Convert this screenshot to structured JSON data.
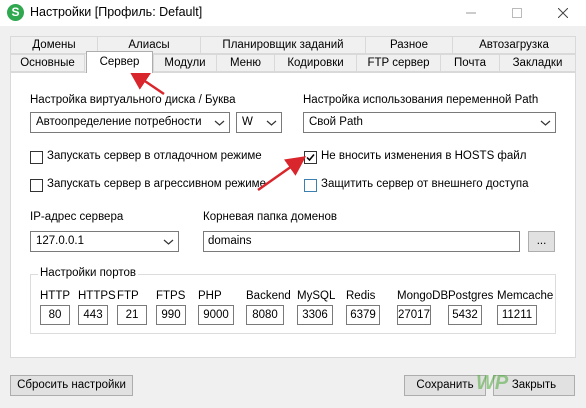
{
  "window": {
    "title": "Настройки [Профиль: Default]",
    "app_icon_letter": "S"
  },
  "tabs": {
    "row1": [
      "Домены",
      "Алиасы",
      "Планировщик заданий",
      "Разное",
      "Автозагрузка"
    ],
    "row2": [
      "Основные",
      "Сервер",
      "Модули",
      "Меню",
      "Кодировки",
      "FTP сервер",
      "Почта",
      "Закладки"
    ],
    "active": "Сервер"
  },
  "disk": {
    "label": "Настройка виртуального диска / Буква",
    "mode_value": "Автоопределение потребности",
    "letter_value": "W"
  },
  "path": {
    "label": "Настройка использования переменной Path",
    "value": "Свой Path"
  },
  "checkboxes": {
    "debug_mode": "Запускать сервер в отладочном режиме",
    "aggressive_mode": "Запускать сервер в агрессивном режиме",
    "no_hosts": "Не вносить изменения в HOSTS файл",
    "protect_external": "Защитить сервер от внешнего доступа"
  },
  "checkbox_states": {
    "debug_mode": false,
    "aggressive_mode": false,
    "no_hosts": true,
    "protect_external": false
  },
  "ip": {
    "label": "IP-адрес сервера",
    "value": "127.0.0.1"
  },
  "domains_folder": {
    "label": "Корневая папка доменов",
    "value": "domains",
    "browse_label": "..."
  },
  "ports": {
    "group_label": "Настройки портов",
    "items": [
      {
        "name": "HTTP",
        "value": "80"
      },
      {
        "name": "HTTPS",
        "value": "443"
      },
      {
        "name": "FTP",
        "value": "21"
      },
      {
        "name": "FTPS",
        "value": "990"
      },
      {
        "name": "PHP",
        "value": "9000"
      },
      {
        "name": "Backend",
        "value": "8080"
      },
      {
        "name": "MySQL",
        "value": "3306"
      },
      {
        "name": "Redis",
        "value": "6379"
      },
      {
        "name": "MongoDB",
        "value": "27017"
      },
      {
        "name": "Postgres",
        "value": "5432"
      },
      {
        "name": "Memcache",
        "value": "11211"
      }
    ]
  },
  "footer": {
    "reset_label": "Сбросить настройки",
    "save_label": "Сохранить",
    "close_label": "Закрыть"
  },
  "watermark": "WP",
  "colors": {
    "annotation_arrow": "#d9262c",
    "app_icon": "#2fa84f"
  }
}
